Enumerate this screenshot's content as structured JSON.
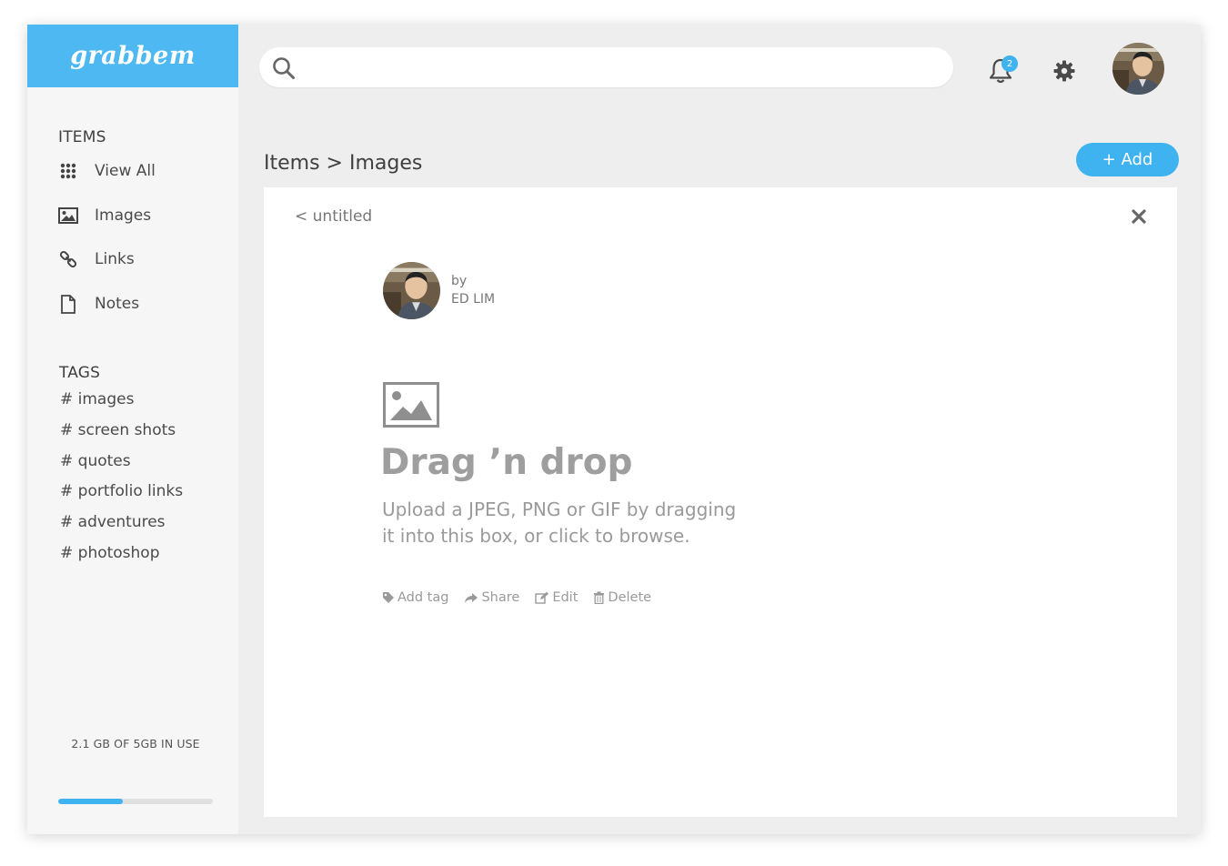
{
  "app": {
    "logo": "grabbem"
  },
  "sidebar": {
    "items_title": "ITEMS",
    "items": [
      {
        "label": "View All",
        "icon": "grid-icon"
      },
      {
        "label": "Images",
        "icon": "image-icon"
      },
      {
        "label": "Links",
        "icon": "link-icon"
      },
      {
        "label": "Notes",
        "icon": "note-icon"
      }
    ],
    "tags_title": "TAGS",
    "tags": [
      "# images",
      "# screen shots",
      "# quotes",
      "# portfolio links",
      "# adventures",
      "# photoshop"
    ],
    "storage": {
      "text": "2.1 GB OF 5GB IN USE",
      "used_fraction": 0.42
    }
  },
  "header": {
    "search": {
      "placeholder": "",
      "value": ""
    },
    "notification_count": "2"
  },
  "main": {
    "breadcrumb": "Items > Images",
    "add_button": "+ Add",
    "panel": {
      "back_label": "<  untitled",
      "author_by": "by",
      "author_name": "ED LIM",
      "drop_title": "Drag ’n drop",
      "drop_desc": "Upload a JPEG, PNG or GIF by dragging it into this box, or click to browse.",
      "actions": [
        {
          "label": "Add tag",
          "icon": "tag-icon"
        },
        {
          "label": "Share",
          "icon": "share-icon"
        },
        {
          "label": "Edit",
          "icon": "edit-icon"
        },
        {
          "label": "Delete",
          "icon": "trash-icon"
        }
      ]
    }
  },
  "colors": {
    "accent": "#3fb3f0",
    "logo_bg": "#4db8f2",
    "sidebar_bg": "#f6f6f6",
    "main_bg": "#eeeeee"
  }
}
